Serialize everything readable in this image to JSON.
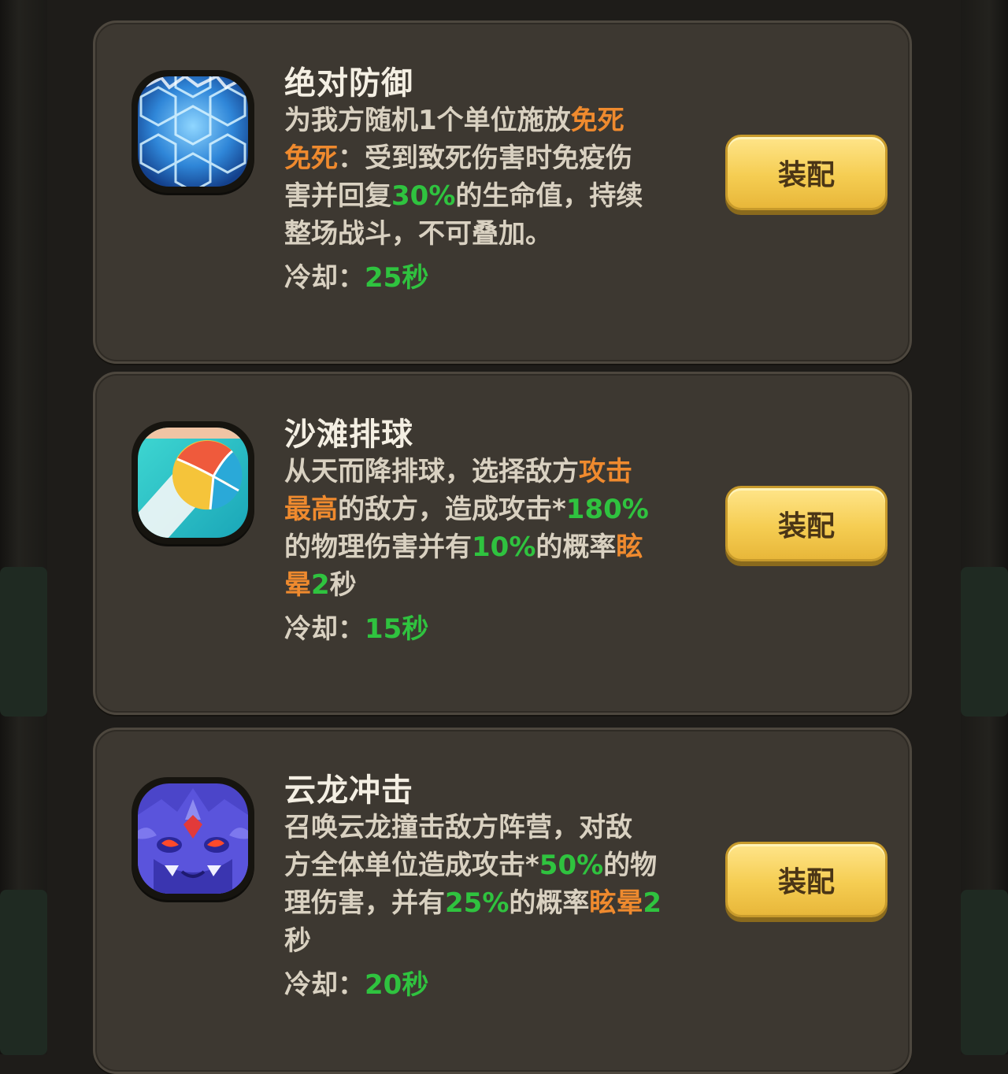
{
  "skills": [
    {
      "name": "绝对防御",
      "icon": "shield-hexagon-icon",
      "desc": [
        {
          "t": "为我方随机1个单位施放",
          "c": "n"
        },
        {
          "t": "免死",
          "c": "o"
        },
        {
          "t": "\n",
          "c": "br"
        },
        {
          "t": "免死",
          "c": "o"
        },
        {
          "t": "：受到致死伤害时免疫伤",
          "c": "n"
        },
        {
          "t": "\n",
          "c": "br"
        },
        {
          "t": "害并回复",
          "c": "n"
        },
        {
          "t": "30%",
          "c": "g"
        },
        {
          "t": "的生命值，持续",
          "c": "n"
        },
        {
          "t": "\n",
          "c": "br"
        },
        {
          "t": "整场战斗，不可叠加。",
          "c": "n"
        }
      ],
      "cooldown_label": "冷却：",
      "cooldown_value": "25秒",
      "button": "装配"
    },
    {
      "name": "沙滩排球",
      "icon": "volleyball-icon",
      "desc": [
        {
          "t": "从天而降排球，选择敌方",
          "c": "n"
        },
        {
          "t": "攻击",
          "c": "o"
        },
        {
          "t": "\n",
          "c": "br"
        },
        {
          "t": "最高",
          "c": "o"
        },
        {
          "t": "的敌方，造成攻击*",
          "c": "n"
        },
        {
          "t": "180%",
          "c": "g"
        },
        {
          "t": "\n",
          "c": "br"
        },
        {
          "t": "的物理伤害并有",
          "c": "n"
        },
        {
          "t": "10%",
          "c": "g"
        },
        {
          "t": "的概率",
          "c": "n"
        },
        {
          "t": "眩",
          "c": "o"
        },
        {
          "t": "\n",
          "c": "br"
        },
        {
          "t": "晕",
          "c": "o"
        },
        {
          "t": "2",
          "c": "g"
        },
        {
          "t": "秒",
          "c": "n"
        }
      ],
      "cooldown_label": "冷却：",
      "cooldown_value": "15秒",
      "button": "装配"
    },
    {
      "name": "云龙冲击",
      "icon": "cloud-dragon-icon",
      "desc": [
        {
          "t": "召唤云龙撞击敌方阵营，对敌",
          "c": "n"
        },
        {
          "t": "\n",
          "c": "br"
        },
        {
          "t": "方全体单位造成攻击*",
          "c": "n"
        },
        {
          "t": "50%",
          "c": "g"
        },
        {
          "t": "的物",
          "c": "n"
        },
        {
          "t": "\n",
          "c": "br"
        },
        {
          "t": "理伤害，并有",
          "c": "n"
        },
        {
          "t": "25%",
          "c": "g"
        },
        {
          "t": "的概率",
          "c": "n"
        },
        {
          "t": "眩晕",
          "c": "o"
        },
        {
          "t": "2",
          "c": "g"
        },
        {
          "t": "\n",
          "c": "br"
        },
        {
          "t": "秒",
          "c": "n"
        }
      ],
      "cooldown_label": "冷却：",
      "cooldown_value": "20秒",
      "button": "装配"
    }
  ],
  "colors": {
    "highlight_orange": "#ef8a2e",
    "highlight_green": "#2fc33f",
    "button_yellow": "#f5cd52",
    "card_bg": "#3d3831"
  }
}
